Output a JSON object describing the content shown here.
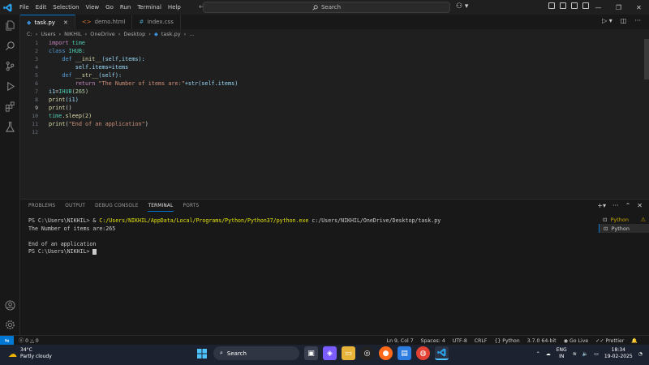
{
  "menu": [
    "File",
    "Edit",
    "Selection",
    "View",
    "Go",
    "Run",
    "Terminal",
    "Help"
  ],
  "search": {
    "label": "Search"
  },
  "tabs": [
    {
      "label": "task.py",
      "icon": "python-file-icon",
      "active": true
    },
    {
      "label": "demo.html",
      "icon": "html-file-icon",
      "active": false
    },
    {
      "label": "index.css",
      "icon": "css-file-icon",
      "active": false
    }
  ],
  "breadcrumb": [
    "C:",
    "Users",
    "NIKHIL",
    "OneDrive",
    "Desktop",
    "task.py",
    "..."
  ],
  "code": {
    "line_numbers": [
      "1",
      "2",
      "3",
      "4",
      "5",
      "6",
      "7",
      "8",
      "9",
      "10",
      "11",
      "12"
    ],
    "l1": {
      "kw": "import",
      "rest": " time"
    },
    "l2": {
      "kw": "class",
      "name": " IHUB:"
    },
    "l3": {
      "indent": "    ",
      "kw": "def",
      "fn": " __init__",
      "args": "(self,items):"
    },
    "l4": {
      "indent": "        ",
      "text": "self.items=items"
    },
    "l5": {
      "indent": "    ",
      "kw": "def",
      "fn": " __str__",
      "args": "(self):"
    },
    "l6": {
      "indent": "        ",
      "kw": "return",
      "str": " \"The Number of items are:\"",
      "rest": "+str(self.items)"
    },
    "l7": {
      "var": "i1",
      "op": "=",
      "cls": "IHUB",
      "rest": "(265)"
    },
    "l8": {
      "fn": "print",
      "rest": "(i1)"
    },
    "l9": {
      "fn": "print",
      "rest": "()"
    },
    "l10": {
      "var": "time",
      "rest": ".sleep(2)"
    },
    "l11": {
      "fn": "print",
      "open": "(",
      "str": "\"End of an application\"",
      "close": ")"
    }
  },
  "panel": {
    "tabs": [
      "PROBLEMS",
      "OUTPUT",
      "DEBUG CONSOLE",
      "TERMINAL",
      "PORTS"
    ],
    "active_tab": "TERMINAL",
    "terminal": {
      "l1_prompt": "PS C:\\Users\\NIKHIL> ",
      "l1_amp": "& ",
      "l1_exe": "C:/Users/NIKHIL/AppData/Local/Programs/Python/Python37/python.exe",
      "l1_arg": " c:/Users/NIKHIL/OneDrive/Desktop/task.py",
      "l2": "The Number of items are:265",
      "l3": "",
      "l4": "End of an application",
      "l5": "PS C:\\Users\\NIKHIL> "
    },
    "terminal_list": [
      "Python",
      "Python"
    ]
  },
  "status": {
    "problems": "0",
    "warnings": "0",
    "position": "Ln 9, Col 7",
    "spaces": "Spaces: 4",
    "encoding": "UTF-8",
    "eol": "CRLF",
    "language": "Python",
    "interpreter": "3.7.0 64-bit",
    "golive": "Go Live",
    "prettier": "Prettier"
  },
  "taskbar": {
    "weather_temp": "34°C",
    "weather_desc": "Partly cloudy",
    "search": "Search",
    "lang1": "ENG",
    "lang2": "IN",
    "time": "18:34",
    "date": "19-02-2025"
  },
  "colors": {
    "accent": "#0078d4",
    "bg": "#1f1f1f",
    "taskbar": "#1c2230"
  }
}
